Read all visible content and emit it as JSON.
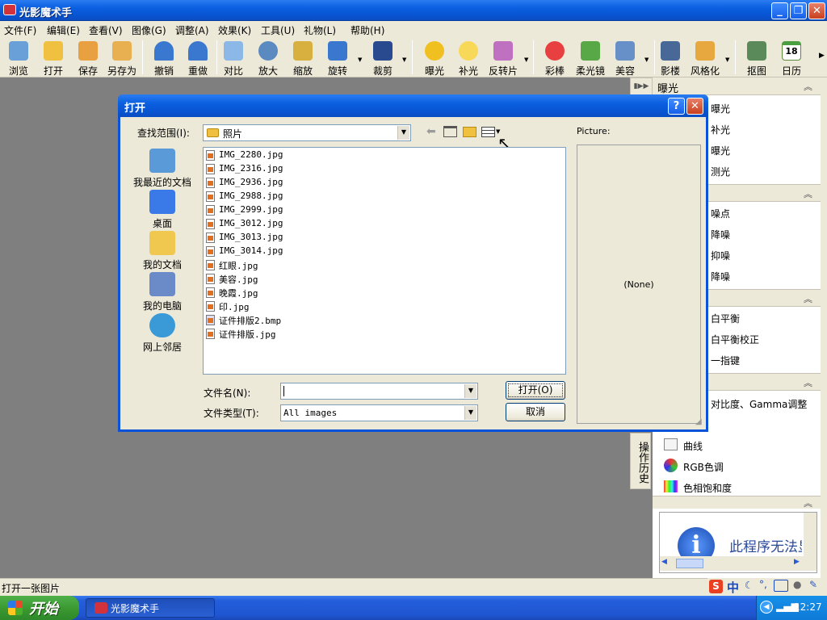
{
  "app": {
    "title": "光影魔术手"
  },
  "menu": [
    "文件(F)",
    "编辑(E)",
    "查看(V)",
    "图像(G)",
    "调整(A)",
    "效果(K)",
    "工具(U)",
    "礼物(L)",
    "帮助(H)"
  ],
  "toolbar": [
    "浏览",
    "打开",
    "保存",
    "另存为",
    "撤销",
    "重做",
    "对比",
    "放大",
    "缩放",
    "旋转",
    "裁剪",
    "曝光",
    "补光",
    "反转片",
    "彩棒",
    "柔光镜",
    "美容",
    "影楼",
    "风格化",
    "抠图",
    "日历"
  ],
  "calendar_day": "18",
  "right_panel": {
    "header": "曝光",
    "sections": [
      {
        "items": [
          "曝光",
          "补光",
          "曝光",
          "测光"
        ]
      },
      {
        "items": [
          "噪点",
          "降噪",
          "抑噪",
          "降噪"
        ]
      },
      {
        "items": [
          "白平衡",
          "白平衡校正",
          "一指键"
        ]
      },
      {
        "items": [
          "对比度、Gamma调整",
          "曲线",
          "RGB色调",
          "色相饱和度"
        ]
      }
    ],
    "history_tab": "操作历史",
    "ad_text": "此程序无法显"
  },
  "status": {
    "text": "打开一张图片"
  },
  "taskbar": {
    "start": "开始",
    "task": "光影魔术手",
    "time": "12:27",
    "ime": "中"
  },
  "dialog": {
    "title": "打开",
    "look_in_label": "查找范围(I):",
    "look_in_value": "照片",
    "preview_label": "Picture:",
    "preview_value": "(None)",
    "places": [
      "我最近的文档",
      "桌面",
      "我的文档",
      "我的电脑",
      "网上邻居"
    ],
    "files": [
      "IMG_2280.jpg",
      "IMG_2316.jpg",
      "IMG_2936.jpg",
      "IMG_2988.jpg",
      "IMG_2999.jpg",
      "IMG_3012.jpg",
      "IMG_3013.jpg",
      "IMG_3014.jpg",
      "红眼.jpg",
      "美容.jpg",
      "晚霞.jpg",
      "印.jpg",
      "证件排版2.bmp",
      "证件排版.jpg"
    ],
    "filename_label": "文件名(N):",
    "filename_value": "",
    "filetype_label": "文件类型(T):",
    "filetype_value": "All images",
    "open_button": "打开(O)",
    "cancel_button": "取消"
  },
  "colors": {
    "title_blue": "#0a5fe0",
    "face": "#ece9d8",
    "desktop": "#7f7f7f"
  }
}
